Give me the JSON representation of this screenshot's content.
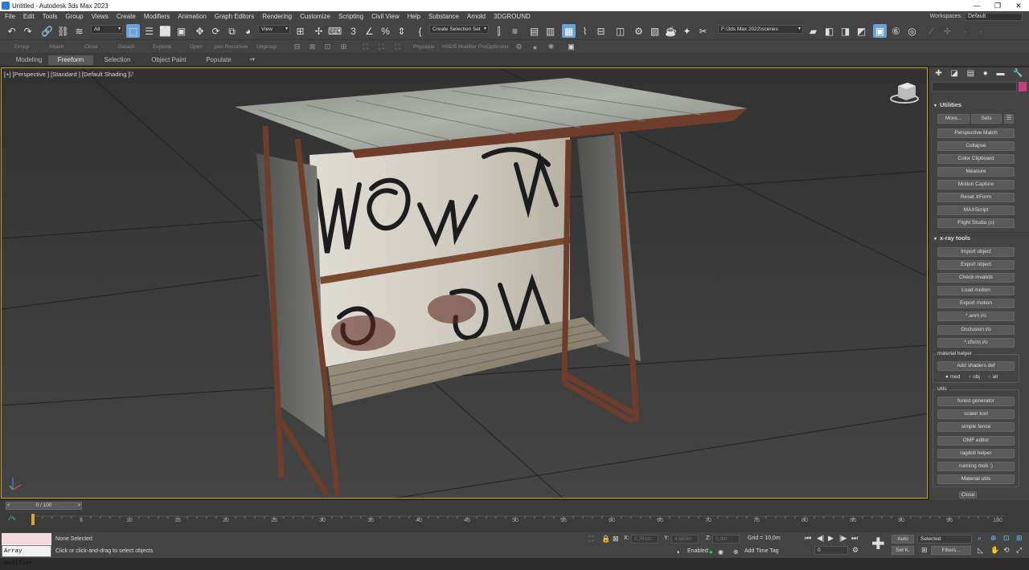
{
  "window": {
    "title": "Untitled - Autodesk 3ds Max 2023",
    "minimize": "—",
    "maximize": "❐",
    "close": "✕"
  },
  "menu": [
    "File",
    "Edit",
    "Tools",
    "Group",
    "Views",
    "Create",
    "Modifiers",
    "Animation",
    "Graph Editors",
    "Rendering",
    "Customize",
    "Scripting",
    "Civil View",
    "Help",
    "Substance",
    "Arnold",
    "3DGROUND"
  ],
  "workspace": {
    "label": "Workspaces:",
    "value": "Default"
  },
  "toolbar": {
    "filter": "All",
    "view": "View",
    "selection_set": "Create Selection Set",
    "path": "F:\\3ds Max 2022\\scenes"
  },
  "toolbar2": {
    "group": "Group",
    "attach": "Attach",
    "close": "Close",
    "detach": "Detach",
    "explode": "Explode",
    "open": "Open",
    "open_recursive": "pen Recursive",
    "ungroup": "Ungroup",
    "physique": "Physique",
    "hsds": "HSDS Modifier",
    "proopt": "ProOptimizer"
  },
  "ribbon": {
    "tabs": [
      "Modeling",
      "Freeform",
      "Selection",
      "Object Paint",
      "Populate"
    ],
    "active": "Freeform"
  },
  "viewport": {
    "label": "[+] [Perspective ] [Standard ] [Default Shading ]"
  },
  "utilities": {
    "title": "Utilities",
    "more": "More...",
    "sets": "Sets",
    "buttons": [
      "Perspective Match",
      "Collapse",
      "Color Clipboard",
      "Measure",
      "Motion Capture",
      "Reset XForm",
      "MAXScript",
      "Flight Studio (c)"
    ]
  },
  "xray": {
    "title": "x-ray tools",
    "buttons": [
      "Import object",
      "Export object",
      "Check invalids",
      "Load motion",
      "Export motion",
      "*.anm i/o",
      "Occlusion i/o",
      "*.cform i/o"
    ],
    "material_helper": {
      "label": "material helper",
      "button": "Add shaders def",
      "radios": [
        "med",
        "obj",
        "all"
      ]
    },
    "utils": {
      "label": "utils",
      "buttons": [
        "forest generator",
        "scaler tool",
        "simple fence",
        "OMF editor",
        "ragdoll helper",
        "running mob :)",
        "Material utils"
      ]
    },
    "close": "Close"
  },
  "timeline": {
    "frame": "0 / 100",
    "ticks": [
      "5",
      "10",
      "15",
      "20",
      "25",
      "30",
      "35",
      "40",
      "45",
      "50",
      "55",
      "60",
      "65",
      "70",
      "75",
      "80",
      "85",
      "90",
      "95",
      "100"
    ]
  },
  "status": {
    "selection": "None Selected",
    "prompt": "Click or click-and-drag to select objects",
    "maxscript_text": "Array modifier",
    "x_label": "X:",
    "x_value": "0,761m",
    "y_label": "Y:",
    "y_value": "4,683m",
    "z_label": "Z:",
    "z_value": "0,0m",
    "grid": "Grid = 10,0m",
    "enabled": "Enabled:",
    "add_time_tag": "Add Time Tag",
    "auto": "Auto",
    "setk": "Set K.",
    "selected": "Selected",
    "filters": "Filters...",
    "frame_field": "0"
  }
}
